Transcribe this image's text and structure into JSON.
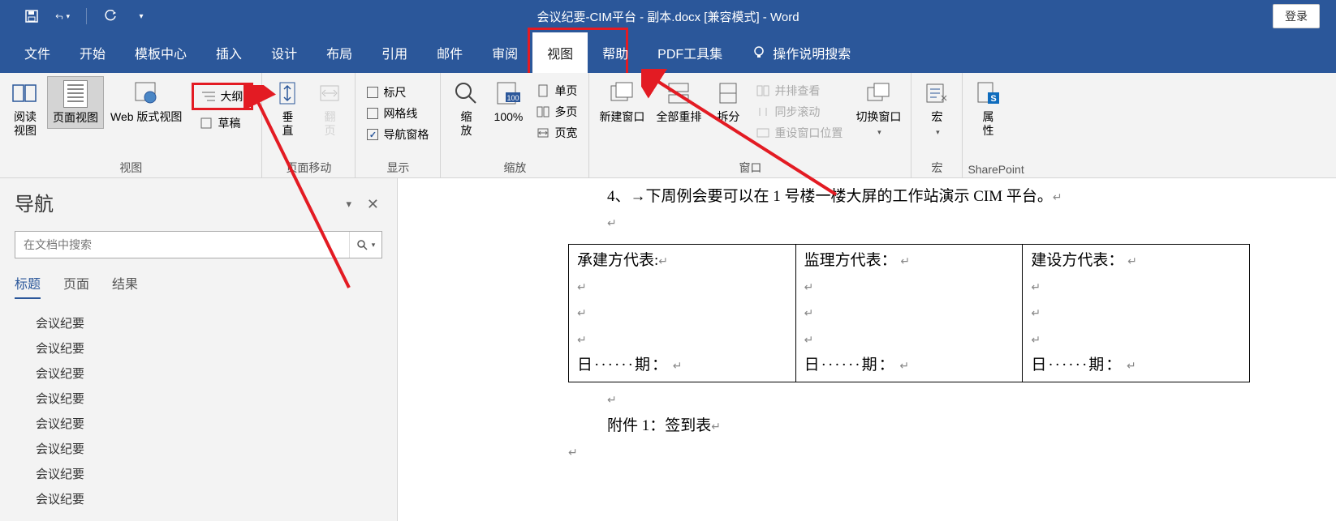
{
  "title": "会议纪要-CIM平台 - 副本.docx [兼容模式]  -  Word",
  "login": "登录",
  "tabs": [
    "文件",
    "开始",
    "模板中心",
    "插入",
    "设计",
    "布局",
    "引用",
    "邮件",
    "审阅",
    "视图",
    "帮助",
    "PDF工具集"
  ],
  "active_tab": "视图",
  "tell_me": "操作说明搜索",
  "ribbon": {
    "views": {
      "label": "视图",
      "read": "阅读\n视图",
      "page": "页面视图",
      "web": "Web 版式视图",
      "outline": "大纲",
      "draft": "草稿"
    },
    "move": {
      "label": "页面移动",
      "vertical": "垂\n直",
      "flip": "翻\n页"
    },
    "show": {
      "label": "显示",
      "ruler": "标尺",
      "grid": "网格线",
      "nav": "导航窗格"
    },
    "zoom": {
      "label": "缩放",
      "zoom": "缩\n放",
      "pct": "100%",
      "one": "单页",
      "multi": "多页",
      "width": "页宽"
    },
    "window": {
      "label": "窗口",
      "new": "新建窗口",
      "arrange": "全部重排",
      "split": "拆分",
      "side": "并排查看",
      "sync": "同步滚动",
      "reset": "重设窗口位置",
      "switch": "切换窗口"
    },
    "macro": {
      "label": "宏",
      "macro": "宏"
    },
    "sp": {
      "label": "SharePoint",
      "prop": "属\n性"
    }
  },
  "nav": {
    "title": "导航",
    "placeholder": "在文档中搜索",
    "tabs": [
      "标题",
      "页面",
      "结果"
    ],
    "items": [
      "会议纪要",
      "会议纪要",
      "会议纪要",
      "会议纪要",
      "会议纪要",
      "会议纪要",
      "会议纪要",
      "会议纪要"
    ]
  },
  "doc": {
    "line4": "4、→下周例会要可以在 1 号楼一楼大屏的工作站演示 CIM 平台。",
    "sig": [
      "承建方代表:",
      "监理方代表：",
      "建设方代表："
    ],
    "date": "日······期：",
    "attach": "附件 1：签到表"
  }
}
